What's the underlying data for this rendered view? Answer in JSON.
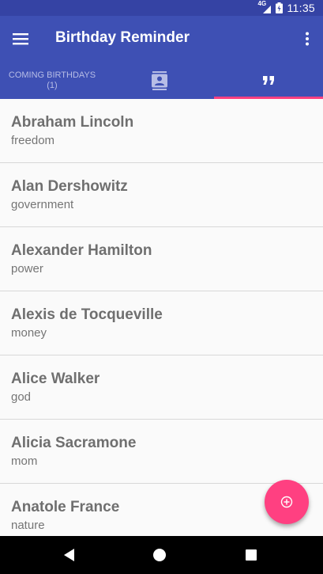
{
  "status_bar": {
    "time": "11:35",
    "network": "4G",
    "network_icon": "signal-icon",
    "battery_icon": "battery-charging-icon"
  },
  "app_bar": {
    "title": "Birthday Reminder",
    "menu_icon": "menu-icon",
    "overflow_icon": "more-vert-icon"
  },
  "tabs": {
    "coming": {
      "label": "COMING BIRTHDAYS",
      "count": "(1)"
    },
    "contacts_icon": "contacts-icon",
    "quotes_icon": "quote-icon",
    "selected": "quotes"
  },
  "quotes": [
    {
      "name": "Abraham Lincoln",
      "topic": "freedom"
    },
    {
      "name": "Alan Dershowitz",
      "topic": "government"
    },
    {
      "name": "Alexander Hamilton",
      "topic": "power"
    },
    {
      "name": "Alexis de Tocqueville",
      "topic": "money"
    },
    {
      "name": "Alice Walker",
      "topic": "god"
    },
    {
      "name": "Alicia Sacramone",
      "topic": "mom"
    },
    {
      "name": "Anatole France",
      "topic": "nature"
    }
  ],
  "fab": {
    "icon": "add-circle-icon"
  },
  "nav_bar": {
    "back_icon": "back-icon",
    "home_icon": "home-icon",
    "recents_icon": "recents-icon"
  },
  "colors": {
    "primary": "#3e50b4",
    "primary_dark": "#3543a4",
    "accent": "#ff4081",
    "tab_inactive_text": "#b7bde6"
  }
}
